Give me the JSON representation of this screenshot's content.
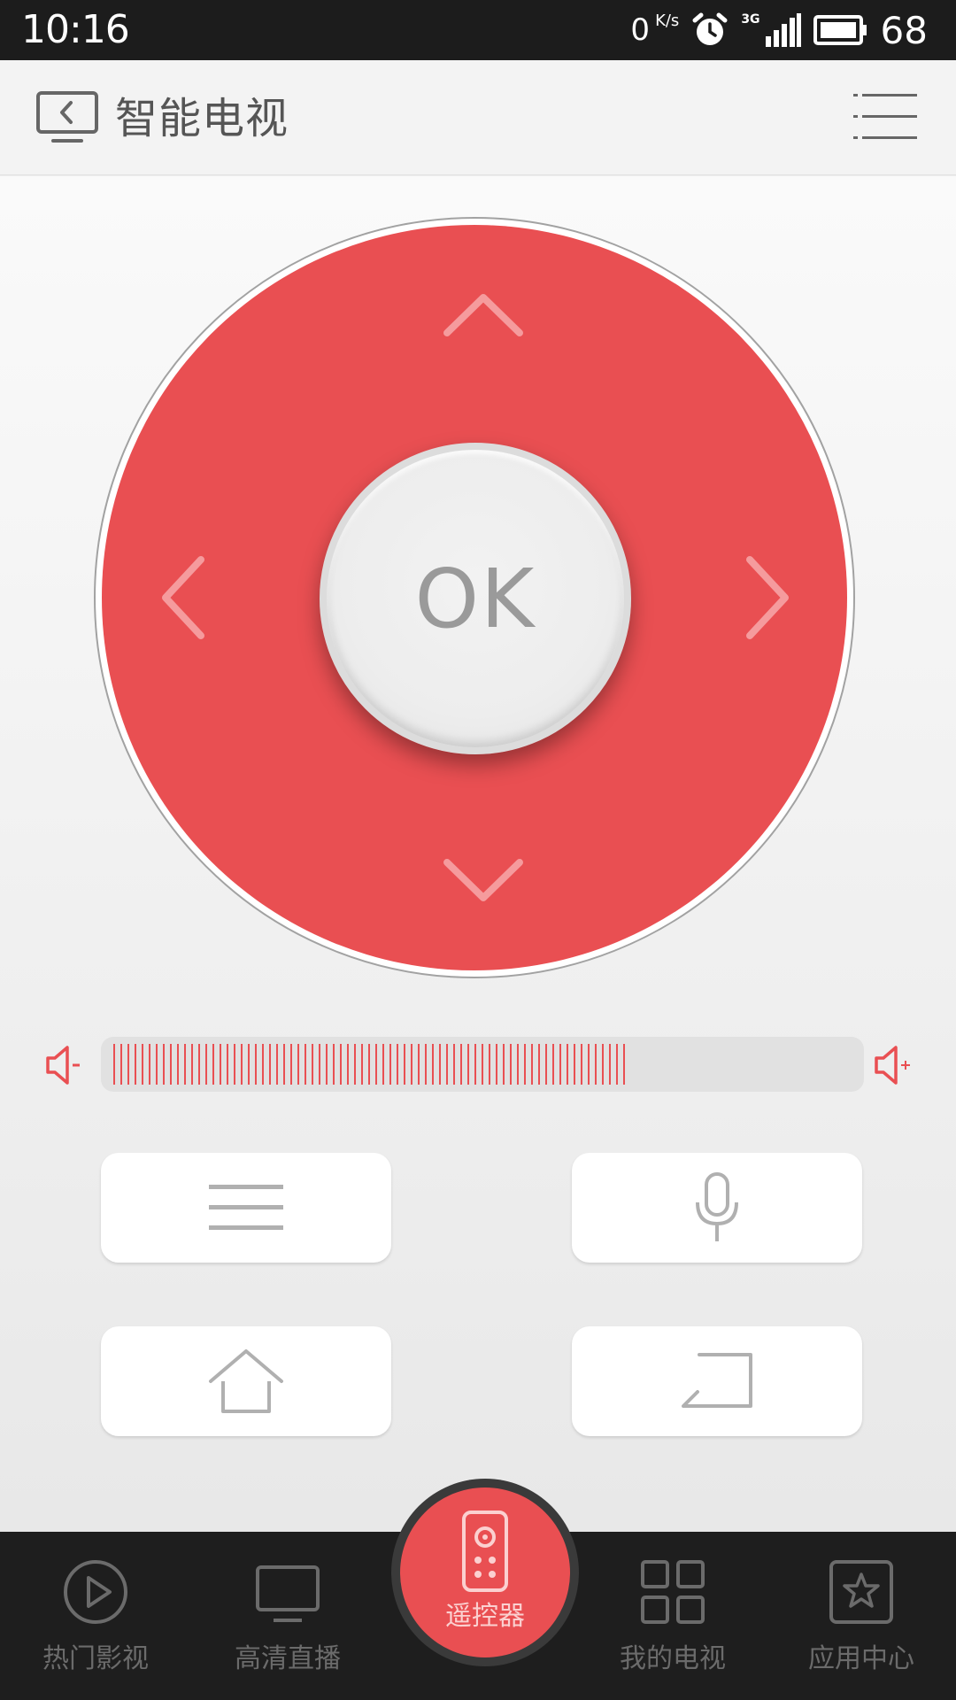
{
  "status_bar": {
    "time": "10:16",
    "net_speed": "0",
    "net_speed_unit": "K/s",
    "network_type": "3G",
    "battery": "68"
  },
  "header": {
    "title": "智能电视"
  },
  "remote": {
    "ok_label": "OK",
    "volume_level": 0.7
  },
  "bottom_nav": {
    "items": [
      {
        "label": "热门影视",
        "icon": "play-circle-icon"
      },
      {
        "label": "高清直播",
        "icon": "monitor-icon"
      },
      {
        "label": "遥控器",
        "icon": "remote-icon",
        "active": true
      },
      {
        "label": "我的电视",
        "icon": "grid-icon"
      },
      {
        "label": "应用中心",
        "icon": "star-box-icon"
      }
    ]
  },
  "colors": {
    "accent": "#e94f52",
    "status_bar": "#1c1c1c",
    "nav_bg": "#1e1e1e"
  }
}
